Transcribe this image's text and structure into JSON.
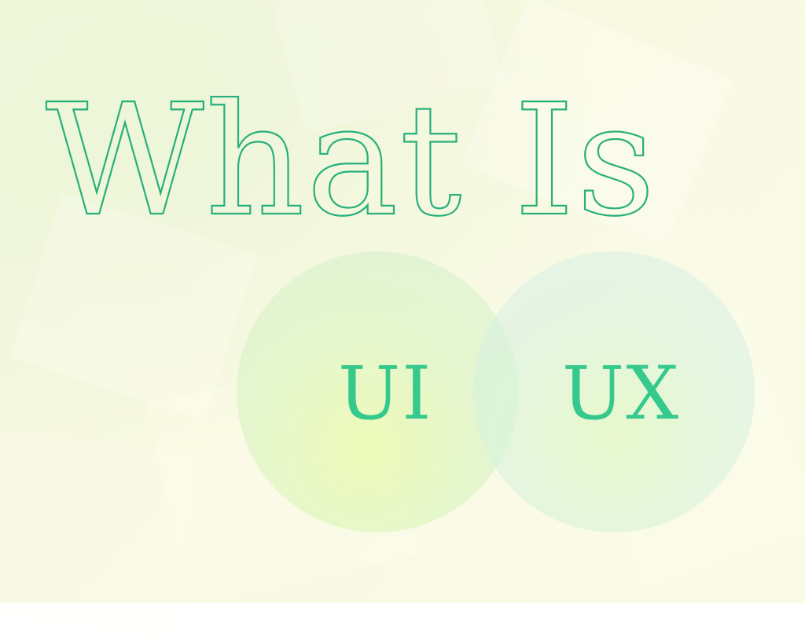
{
  "slide": {
    "title": "What Is",
    "circles": [
      {
        "label": "UI"
      },
      {
        "label": "UX"
      }
    ]
  },
  "colors": {
    "accent": "#26b07a",
    "label": "#35c98d",
    "background": "#f6f8df"
  }
}
